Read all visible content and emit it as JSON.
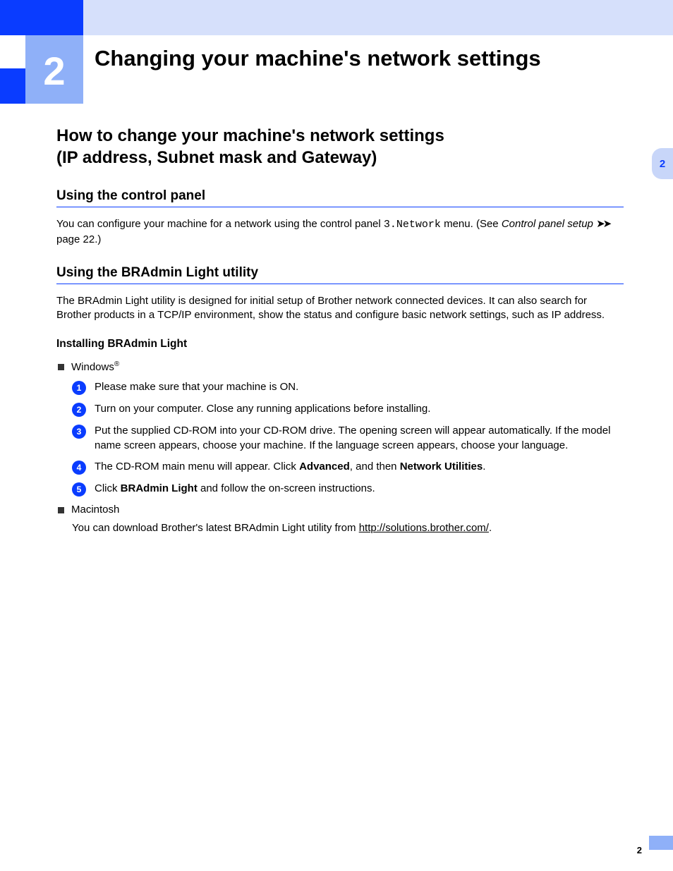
{
  "chapter": {
    "number": "2",
    "title": "Changing your machine's network settings"
  },
  "side_tab": "2",
  "section_heading_l1": "How to change your machine's network settings",
  "section_heading_l2": "(IP address, Subnet mask and Gateway)",
  "sub1": {
    "title": "Using the control panel",
    "p_a": "You can configure your machine for a network using the control panel ",
    "p_mono": "3.Network",
    "p_b": " menu. (See ",
    "p_ital": "Control panel setup",
    "p_c": " page 22.)"
  },
  "sub2": {
    "title": "Using the BRAdmin Light utility",
    "p": "The BRAdmin Light utility is designed for initial setup of Brother network connected devices. It can also search for Brother products in a TCP/IP environment, show the status and configure basic network settings, such as IP address."
  },
  "install_heading": "Installing BRAdmin Light",
  "windows_label": "Windows",
  "windows_sup": "®",
  "steps": [
    {
      "n": "1",
      "text": "Please make sure that your machine is ON."
    },
    {
      "n": "2",
      "text": "Turn on your computer. Close any running applications before installing."
    },
    {
      "n": "3",
      "text": "Put the supplied CD-ROM into your CD-ROM drive. The opening screen will appear automatically. If the model name screen appears, choose your machine. If the language screen appears, choose your language."
    },
    {
      "n": "4",
      "pre": "The CD-ROM main menu will appear. Click ",
      "b1": "Advanced",
      "mid": ", and then ",
      "b2": "Network Utilities",
      "post": "."
    },
    {
      "n": "5",
      "pre": "Click ",
      "b1": "BRAdmin Light",
      "post": " and follow the on-screen instructions."
    }
  ],
  "mac_label": "Macintosh",
  "mac_text_a": "You can download Brother's latest BRAdmin Light utility from ",
  "mac_link": "http://solutions.brother.com/",
  "mac_text_b": ".",
  "page_number": "2"
}
